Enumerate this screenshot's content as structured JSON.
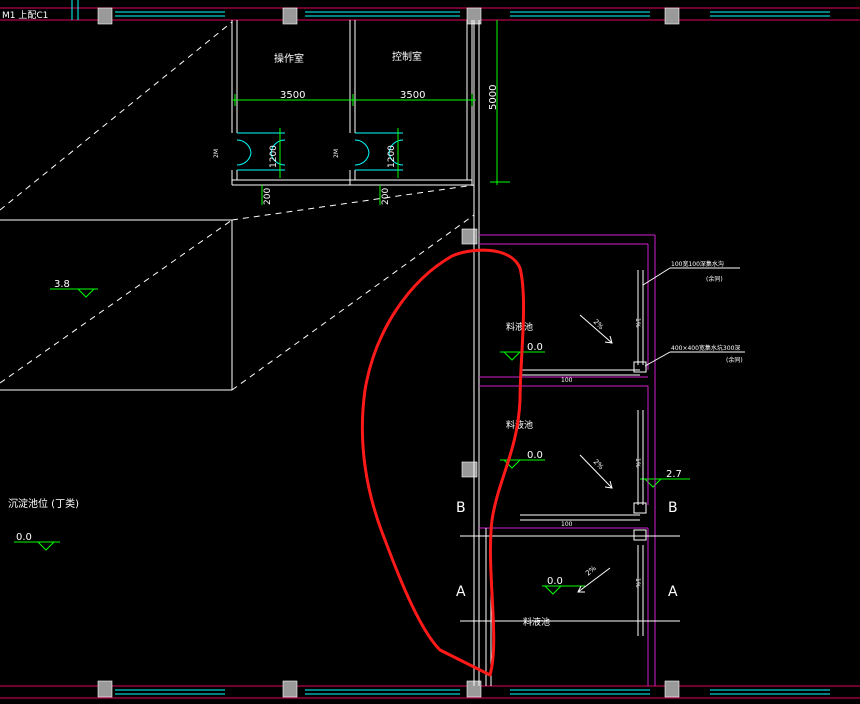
{
  "header": {
    "title": "M1 上配C1"
  },
  "rooms": {
    "operation_room": "操作室",
    "control_room": "控制室",
    "tank_1": "料液池",
    "tank_2": "料液池",
    "tank_3": "料液池"
  },
  "dimensions": {
    "width_left": "3500",
    "width_right": "3500",
    "height_top": "5000",
    "door_height_1": "1200",
    "door_height_2": "1200",
    "door_width_1": "200",
    "door_width_2": "200",
    "door_tag_1": "2M",
    "door_tag_2": "2M",
    "small_dim_1": "100",
    "small_dim_2": "100"
  },
  "levels": {
    "platform": "3.8",
    "tank_1": "0.0",
    "tank_2": "0.0",
    "tank_3": "0.0",
    "right": "2.7",
    "left": "0.0"
  },
  "slopes": {
    "s1": "2%",
    "s2": "2%",
    "s3": "2%",
    "side1": "1%",
    "side2": "1%",
    "side3": "1%"
  },
  "notes": {
    "trench_note": "100宽100深集水沟",
    "trench_note_sub": "(余同)",
    "pit_note": "400×400宽集水坑300深",
    "pit_note_sub": "(余同)",
    "station_label": "沉淀池位 (丁类)"
  },
  "axes": {
    "left_b": "B",
    "left_a": "A",
    "right_b": "B",
    "right_a": "A"
  },
  "colors": {
    "background": "#000000",
    "wall": "#ffffff",
    "dimension": "#00ff00",
    "grid_line": "#e0005a",
    "tank_outline": "#d020d0",
    "highlight": "#ff1a1a",
    "column": "#9a9a9a",
    "door": "#00ffff"
  }
}
